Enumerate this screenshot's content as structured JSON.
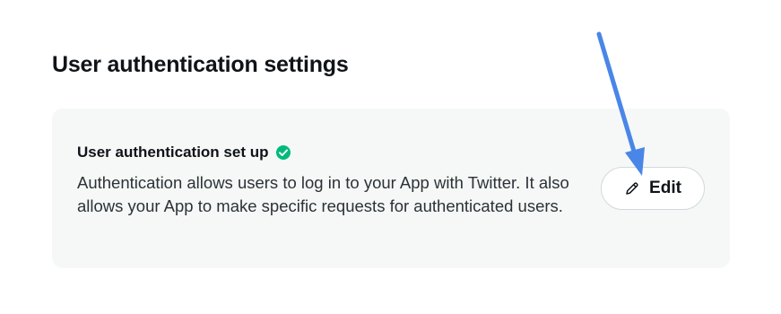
{
  "section": {
    "title": "User authentication settings"
  },
  "card": {
    "heading": "User authentication set up",
    "description": "Authentication allows users to log in to your App with Twitter. It also allows your App to make specific requests for authenticated users.",
    "status_icon": "check-circle-icon",
    "status_color": "#00ba7c"
  },
  "edit_button": {
    "label": "Edit",
    "icon": "pencil-icon"
  },
  "annotation": {
    "arrow_color": "#4a86e8"
  }
}
